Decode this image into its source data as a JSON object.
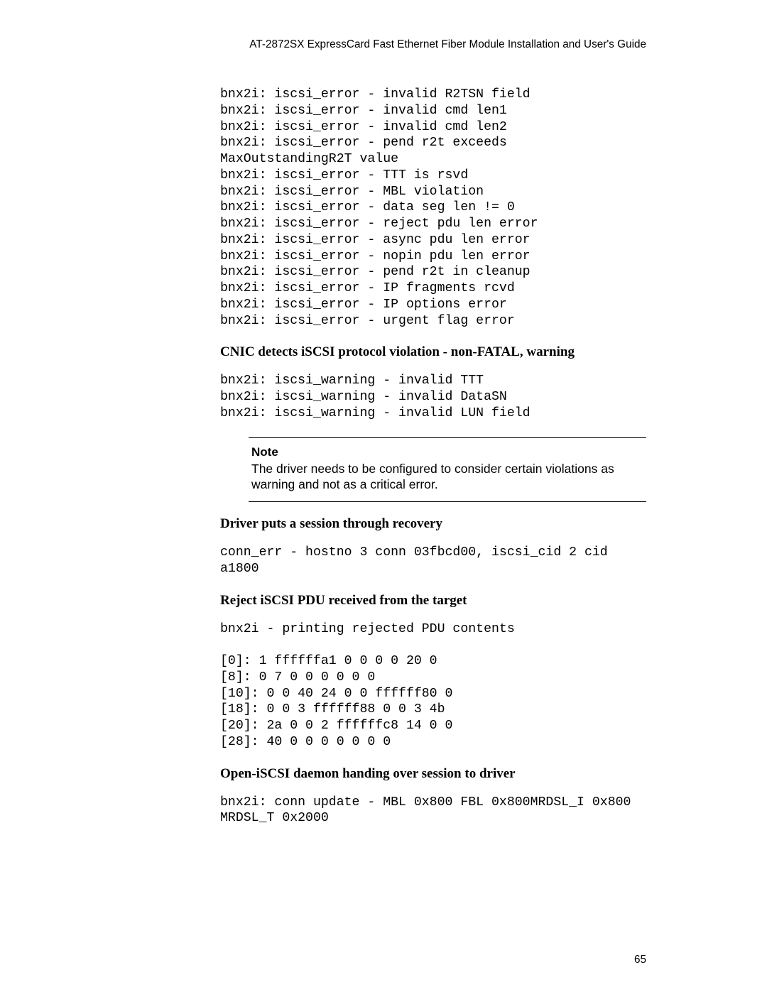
{
  "header": "AT-2872SX ExpressCard Fast Ethernet Fiber Module Installation and User's Guide",
  "code_block1": "bnx2i: iscsi_error - invalid R2TSN field\nbnx2i: iscsi_error - invalid cmd len1\nbnx2i: iscsi_error - invalid cmd len2\nbnx2i: iscsi_error - pend r2t exceeds\nMaxOutstandingR2T value\nbnx2i: iscsi_error - TTT is rsvd\nbnx2i: iscsi_error - MBL violation\nbnx2i: iscsi_error - data seg len != 0\nbnx2i: iscsi_error - reject pdu len error\nbnx2i: iscsi_error - async pdu len error\nbnx2i: iscsi_error - nopin pdu len error\nbnx2i: iscsi_error - pend r2t in cleanup\nbnx2i: iscsi_error - IP fragments rcvd\nbnx2i: iscsi_error - IP options error\nbnx2i: iscsi_error - urgent flag error",
  "subhead1": "CNIC detects iSCSI protocol violation - non-FATAL, warning",
  "code_block2": "bnx2i: iscsi_warning - invalid TTT\nbnx2i: iscsi_warning - invalid DataSN\nbnx2i: iscsi_warning - invalid LUN field",
  "note": {
    "label": "Note",
    "body": "The driver needs to be configured to consider certain violations as warning and not as a critical error."
  },
  "subhead2": "Driver puts a session through recovery",
  "code_block3": "conn_err - hostno 3 conn 03fbcd00, iscsi_cid 2 cid\na1800",
  "subhead3": "Reject iSCSI PDU received from the target",
  "code_block4": "bnx2i - printing rejected PDU contents\n\n[0]: 1 ffffffa1 0 0 0 0 20 0\n[8]: 0 7 0 0 0 0 0 0\n[10]: 0 0 40 24 0 0 ffffff80 0\n[18]: 0 0 3 ffffff88 0 0 3 4b\n[20]: 2a 0 0 2 ffffffc8 14 0 0\n[28]: 40 0 0 0 0 0 0 0",
  "subhead4": "Open-iSCSI daemon handing over session to driver",
  "code_block5": "bnx2i: conn update - MBL 0x800 FBL 0x800MRDSL_I 0x800\nMRDSL_T 0x2000",
  "page_number": "65"
}
